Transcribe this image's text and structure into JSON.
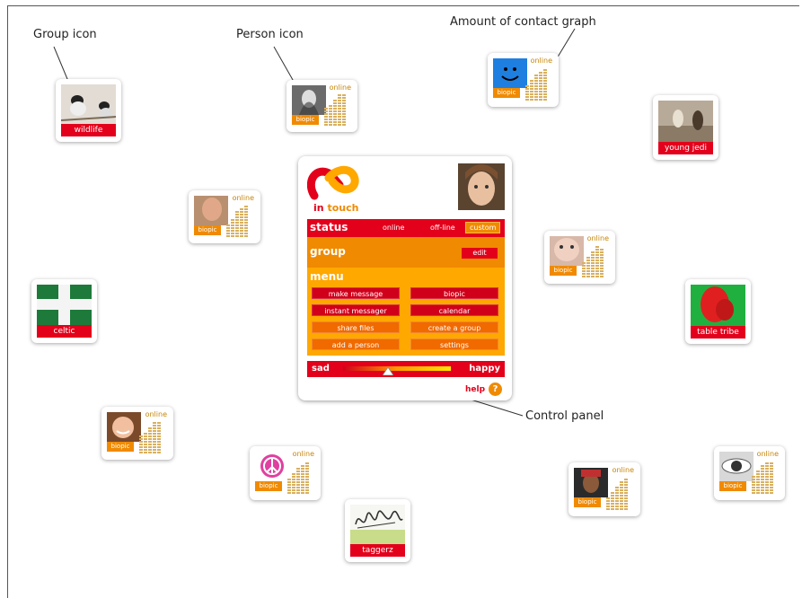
{
  "callouts": {
    "group_icon": "Group icon",
    "person_icon": "Person icon",
    "contact_graph": "Amount of contact graph",
    "control_panel": "Control panel"
  },
  "person_card": {
    "online": "online",
    "biopic": "biopic"
  },
  "groups": {
    "wildlife": "wildlife",
    "young_jedi": "young jedi",
    "celtic": "celtic",
    "table_tribe": "table tribe",
    "taggerz": "taggerz"
  },
  "panel": {
    "logo_word1": "in",
    "logo_word2": "touch",
    "status_title": "status",
    "status_options": [
      "online",
      "off-line",
      "custom"
    ],
    "group_title": "group",
    "edit_label": "edit",
    "menu_title": "menu",
    "menu_items": [
      "make message",
      "biopic",
      "instant messager",
      "calendar",
      "share files",
      "create a group",
      "add a person",
      "settings"
    ],
    "mood_low": "sad",
    "mood_high": "happy",
    "mood_level": 0.42,
    "help_label": "help",
    "help_icon": "?"
  },
  "colors": {
    "red": "#e3001b",
    "orange": "#f08a00",
    "amber": "#ffa800",
    "graph": "#d8b060"
  }
}
